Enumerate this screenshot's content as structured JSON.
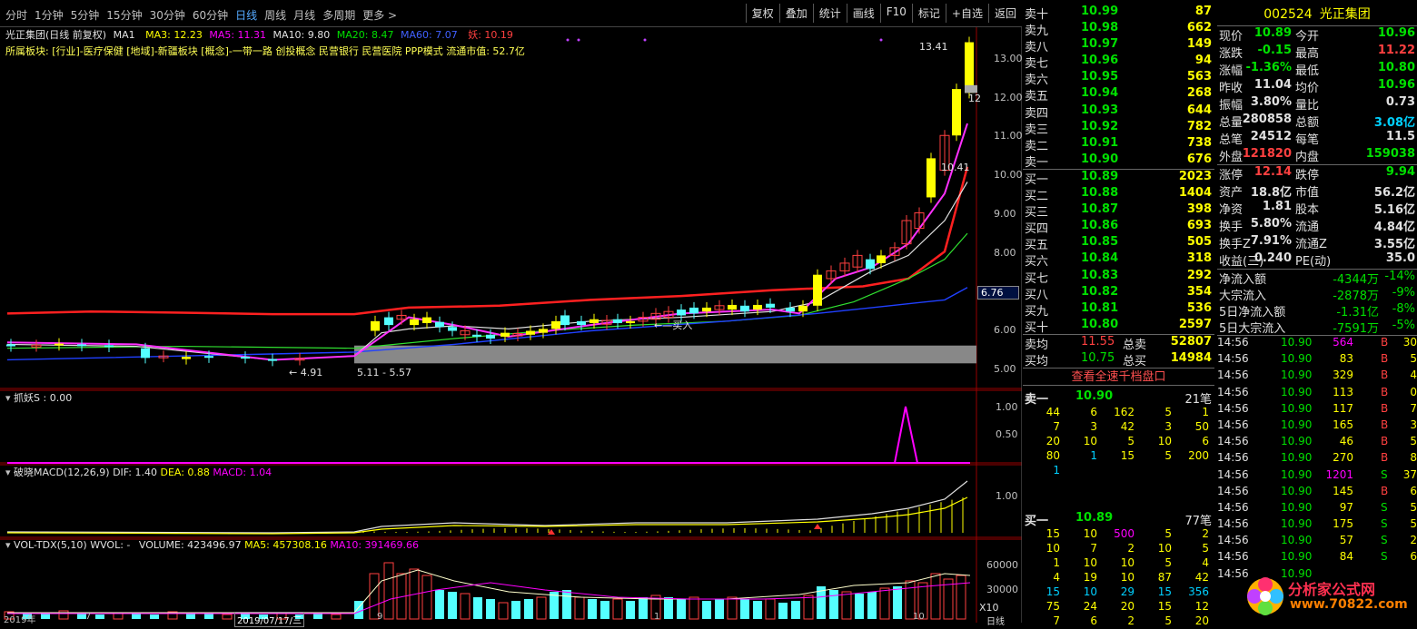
{
  "toolbar": {
    "tabs": [
      "分时",
      "1分钟",
      "5分钟",
      "15分钟",
      "30分钟",
      "60分钟",
      "日线",
      "周线",
      "月线",
      "多周期",
      "更多 >"
    ],
    "active": "日线",
    "actions": [
      "复权",
      "叠加",
      "统计",
      "画线",
      "F10",
      "标记",
      "+自选",
      "返回"
    ]
  },
  "info_line": {
    "name": "光正集团(日线 前复权)",
    "ma1": "MA1",
    "ma3": "MA3: 12.23",
    "ma5": "MA5: 11.31",
    "ma10": "MA10: 9.80",
    "ma20": "MA20: 8.47",
    "ma60": "MA60: 7.07",
    "yao": "妖: 10.19"
  },
  "info_line2": "所属板块: [行业]-医疗保健 [地域]-新疆板块 [概念]-一带一路 创投概念 民营银行 民营医院 PPP模式 流通市值: 52.7亿",
  "price_axis": [
    "13.00",
    "12.00",
    "11.00",
    "10.00",
    "9.00",
    "8.00",
    "7.00",
    "6.00",
    "5.00"
  ],
  "price_tag": "6.76",
  "chart_labels": {
    "high": "13.41",
    "mid": "10.41",
    "low": "4.91",
    "range": "5.11 - 5.57",
    "buy": "买入",
    "twelve": "12"
  },
  "panel_zhuayao": {
    "title": "抓妖S : 0.00",
    "axis": [
      "1.00",
      "0.50"
    ]
  },
  "panel_macd": {
    "title": "破晓MACD(12,26,9)",
    "dif": "DIF: 1.40",
    "dea": "DEA: 0.88",
    "macd": "MACD: 1.04",
    "axis": [
      "1.00"
    ]
  },
  "panel_vol": {
    "title": "VOL-TDX(5,10)",
    "wvol": "WVOL: -",
    "volume": "VOLUME: 423496.97",
    "ma5": "MA5: 457308.16",
    "ma10": "MA10: 391469.66",
    "axis": [
      "60000",
      "30000"
    ],
    "unit": "X10"
  },
  "bottom_axis": [
    "2019年",
    "7",
    "2019/07/17/三",
    "9",
    "1",
    "10"
  ],
  "bottom_right": "日线",
  "orderbook": {
    "asks": [
      [
        "卖十",
        "10.99",
        "87"
      ],
      [
        "卖九",
        "10.98",
        "662"
      ],
      [
        "卖八",
        "10.97",
        "149"
      ],
      [
        "卖七",
        "10.96",
        "94"
      ],
      [
        "卖六",
        "10.95",
        "563"
      ],
      [
        "卖五",
        "10.94",
        "268"
      ],
      [
        "卖四",
        "10.93",
        "644"
      ],
      [
        "卖三",
        "10.92",
        "782"
      ],
      [
        "卖二",
        "10.91",
        "738"
      ],
      [
        "卖一",
        "10.90",
        "676"
      ]
    ],
    "bids": [
      [
        "买一",
        "10.89",
        "2023"
      ],
      [
        "买二",
        "10.88",
        "1404"
      ],
      [
        "买三",
        "10.87",
        "398"
      ],
      [
        "买四",
        "10.86",
        "693"
      ],
      [
        "买五",
        "10.85",
        "505"
      ],
      [
        "买六",
        "10.84",
        "318"
      ],
      [
        "买七",
        "10.83",
        "292"
      ],
      [
        "买八",
        "10.82",
        "354"
      ],
      [
        "买九",
        "10.81",
        "536"
      ],
      [
        "买十",
        "10.80",
        "2597"
      ]
    ],
    "avg_ask": [
      "卖均",
      "11.55",
      "总卖",
      "52807"
    ],
    "avg_bid": [
      "买均",
      "10.75",
      "总买",
      "14984"
    ],
    "view_all": "查看全速千档盘口",
    "ask1_queue": {
      "label": "卖一",
      "price": "10.90",
      "count": "21笔",
      "rows": [
        [
          "44",
          "6",
          "162",
          "5",
          "1"
        ],
        [
          "7",
          "3",
          "42",
          "3",
          "50"
        ],
        [
          "20",
          "10",
          "5",
          "10",
          "6"
        ],
        [
          "80",
          "1",
          "15",
          "5",
          "200"
        ],
        [
          "1",
          "",
          "",
          "",
          ""
        ]
      ]
    },
    "bid1_queue": {
      "label": "买一",
      "price": "10.89",
      "count": "77笔",
      "rows": [
        [
          "15",
          "10",
          "500",
          "5",
          "2"
        ],
        [
          "10",
          "7",
          "2",
          "10",
          "5"
        ],
        [
          "1",
          "10",
          "10",
          "5",
          "4"
        ],
        [
          "4",
          "19",
          "10",
          "87",
          "42"
        ],
        [
          "15",
          "10",
          "29",
          "15",
          "356"
        ],
        [
          "75",
          "24",
          "20",
          "15",
          "12"
        ],
        [
          "7",
          "6",
          "2",
          "5",
          "20"
        ]
      ]
    }
  },
  "summary": {
    "code": "002524",
    "name": "光正集团",
    "rows": [
      [
        "现价",
        "10.89",
        "今开",
        "10.96"
      ],
      [
        "涨跌",
        "-0.15",
        "最高",
        "11.22"
      ],
      [
        "涨幅",
        "-1.36%",
        "最低",
        "10.80"
      ],
      [
        "昨收",
        "11.04",
        "均价",
        "10.96"
      ],
      [
        "振幅",
        "3.80%",
        "量比",
        "0.73"
      ],
      [
        "总量",
        "280858",
        "总额",
        "3.08亿"
      ],
      [
        "总笔",
        "24512",
        "每笔",
        "11.5"
      ],
      [
        "外盘",
        "121820",
        "内盘",
        "159038"
      ]
    ],
    "rows2": [
      [
        "涨停",
        "12.14",
        "跌停",
        "9.94"
      ],
      [
        "资产",
        "18.8亿",
        "市值",
        "56.2亿"
      ],
      [
        "净资",
        "1.81",
        "股本",
        "5.16亿"
      ],
      [
        "换手",
        "5.80%",
        "流通",
        "4.84亿"
      ],
      [
        "换手Z",
        "7.91%",
        "流通Z",
        "3.55亿"
      ],
      [
        "收益(三)",
        "0.240",
        "PE(动)",
        "35.0"
      ]
    ],
    "flows": [
      [
        "净流入额",
        "-4344万",
        "-14%"
      ],
      [
        "大宗流入",
        "-2878万",
        "-9%"
      ],
      [
        "5日净流入额",
        "-1.31亿",
        "-8%"
      ],
      [
        "5日大宗流入",
        "-7591万",
        "-5%"
      ]
    ]
  },
  "ticks": [
    [
      "14:56",
      "10.90",
      "564",
      "B",
      "30"
    ],
    [
      "14:56",
      "10.90",
      "83",
      "B",
      "5"
    ],
    [
      "14:56",
      "10.90",
      "329",
      "B",
      "4"
    ],
    [
      "14:56",
      "10.90",
      "113",
      "B",
      "0"
    ],
    [
      "14:56",
      "10.90",
      "117",
      "B",
      "7"
    ],
    [
      "14:56",
      "10.90",
      "165",
      "B",
      "3"
    ],
    [
      "14:56",
      "10.90",
      "46",
      "B",
      "5"
    ],
    [
      "14:56",
      "10.90",
      "270",
      "B",
      "8"
    ],
    [
      "14:56",
      "10.90",
      "1201",
      "S",
      "37"
    ],
    [
      "14:56",
      "10.90",
      "145",
      "B",
      "6"
    ],
    [
      "14:56",
      "10.90",
      "97",
      "S",
      "5"
    ],
    [
      "14:56",
      "10.90",
      "175",
      "S",
      "5"
    ],
    [
      "14:56",
      "10.90",
      "57",
      "S",
      "2"
    ],
    [
      "14:56",
      "10.90",
      "84",
      "S",
      "6"
    ],
    [
      "14:56",
      "10.90",
      "",
      "",
      " "
    ]
  ],
  "watermark": {
    "title": "分析家公式网",
    "url": "www.70822.com"
  },
  "colors": {
    "up": "#ff4040",
    "down": "#00e000",
    "flat": "#e0e0e0",
    "yellow": "#ffff00",
    "cyan": "#54ffff",
    "magenta": "#ff00ff"
  }
}
